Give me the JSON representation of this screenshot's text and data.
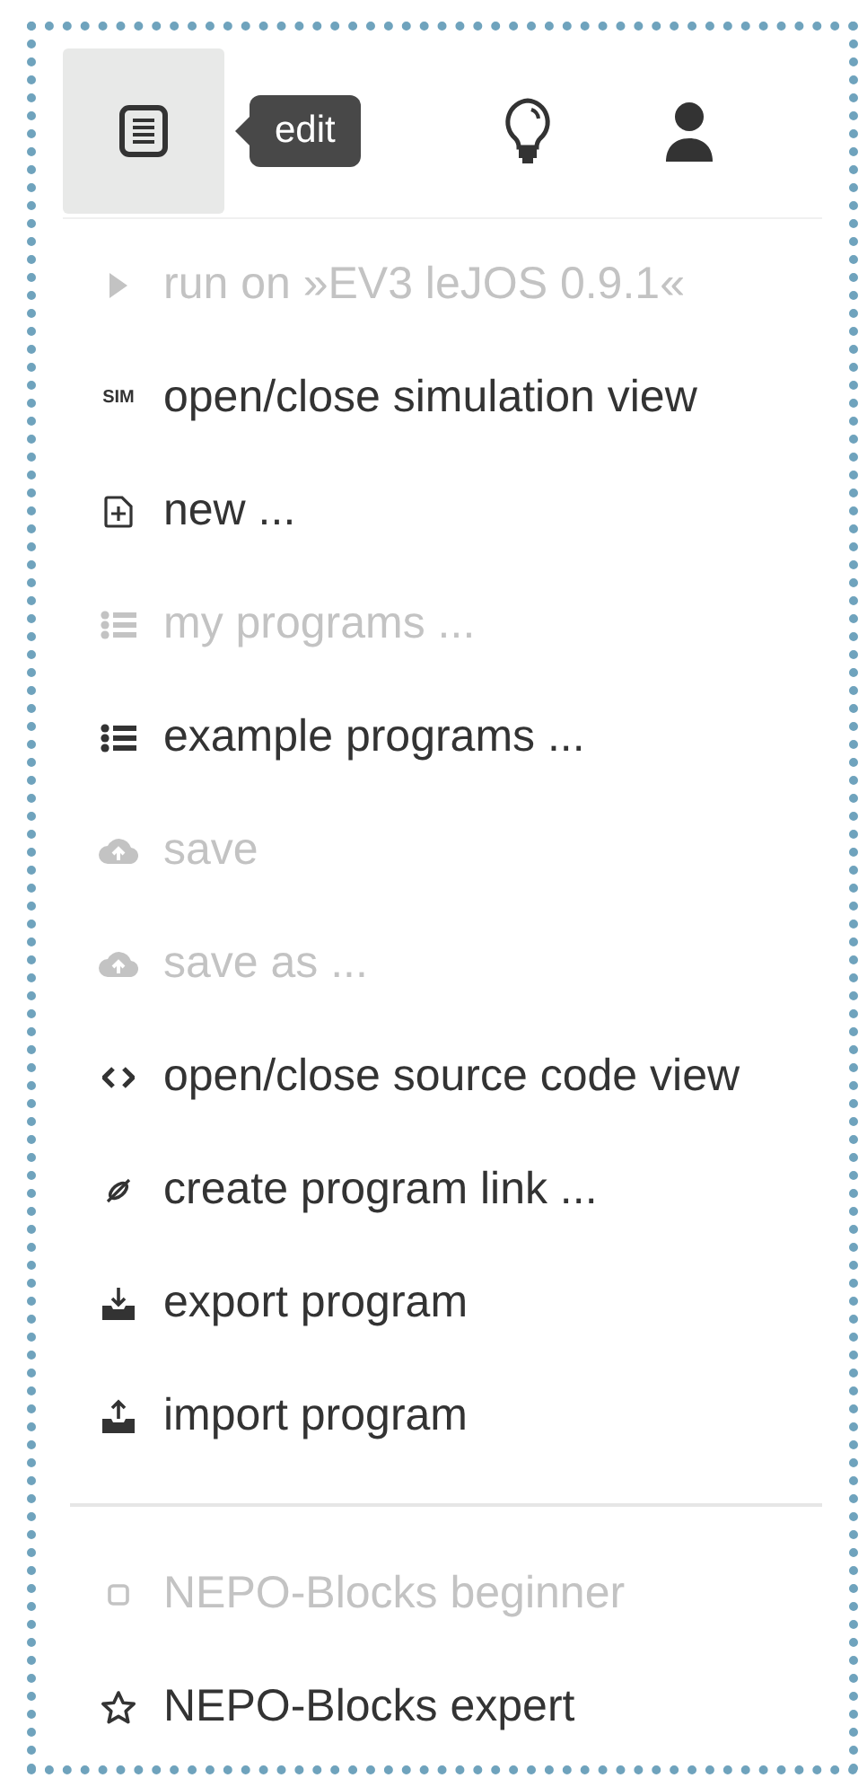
{
  "tabs": [
    {
      "kind": "document",
      "selected": true
    },
    {
      "kind": "bulb",
      "selected": false
    },
    {
      "kind": "user",
      "selected": false
    }
  ],
  "tooltip": {
    "text": "edit"
  },
  "menu": {
    "items": [
      {
        "kind": "play",
        "label": "run on »EV3 leJOS 0.9.1«",
        "disabled": true
      },
      {
        "kind": "sim",
        "icon_text": "SIM",
        "label": "open/close simulation view",
        "disabled": false
      },
      {
        "kind": "file-plus",
        "label": "new ...",
        "disabled": false
      },
      {
        "kind": "list",
        "label": "my programs ...",
        "disabled": true
      },
      {
        "kind": "list",
        "label": "example programs ...",
        "disabled": false
      },
      {
        "kind": "cloud",
        "label": "save",
        "disabled": true
      },
      {
        "kind": "cloud",
        "label": "save as ...",
        "disabled": true
      },
      {
        "kind": "code",
        "label": "open/close source code view",
        "disabled": false
      },
      {
        "kind": "link",
        "label": "create program link ...",
        "disabled": false
      },
      {
        "kind": "export",
        "label": "export program",
        "disabled": false
      },
      {
        "kind": "import",
        "label": "import program",
        "disabled": false
      },
      {
        "kind": "divider"
      },
      {
        "kind": "square",
        "label": "NEPO-Blocks beginner",
        "disabled": true
      },
      {
        "kind": "star",
        "label": "NEPO-Blocks expert",
        "disabled": false
      }
    ]
  }
}
